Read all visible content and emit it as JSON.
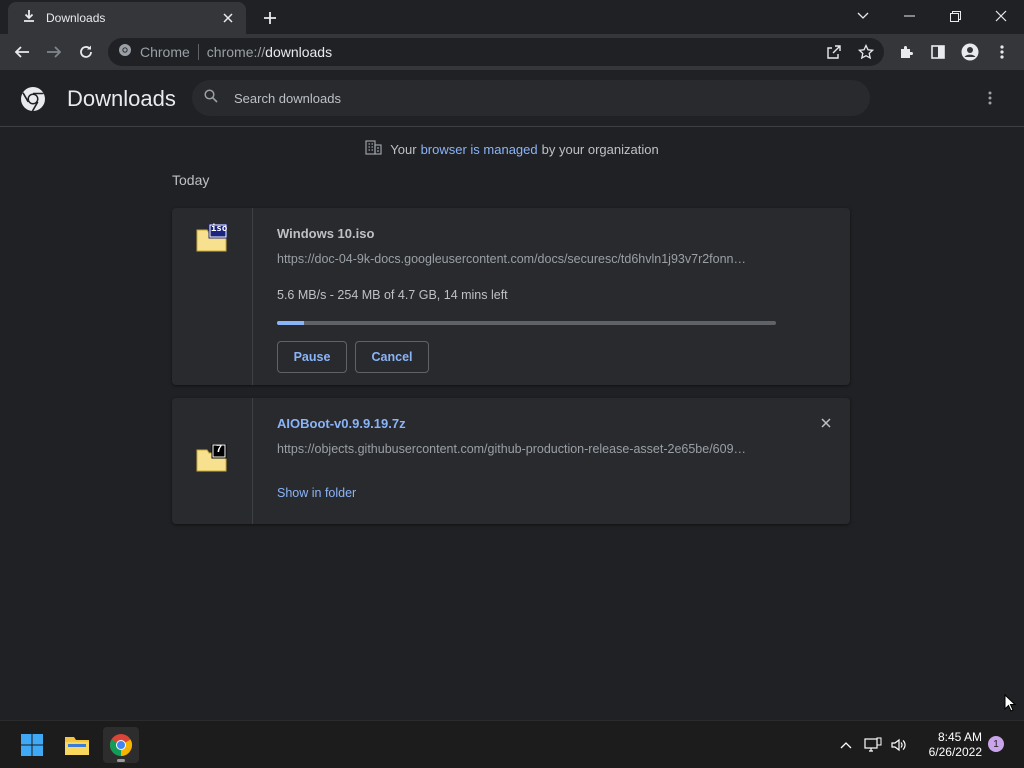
{
  "tab": {
    "title": "Downloads"
  },
  "omnibox": {
    "site": "Chrome",
    "url_prefix": "chrome://",
    "url_path": "downloads"
  },
  "header": {
    "title": "Downloads",
    "search_placeholder": "Search downloads"
  },
  "managed": {
    "prefix": "Your",
    "link": "browser is managed",
    "suffix": "by your organization"
  },
  "section": {
    "date": "Today"
  },
  "downloads": [
    {
      "name": "Windows 10.iso",
      "url": "https://doc-04-9k-docs.googleusercontent.com/docs/securesc/td6hvln1j93v7r2fonn…",
      "status": "5.6 MB/s - 254 MB of 4.7 GB, 14 mins left",
      "progress_fraction": 0.054,
      "icon_label": "iso",
      "pause_label": "Pause",
      "cancel_label": "Cancel"
    },
    {
      "name": "AIOBoot-v0.9.9.19.7z",
      "url": "https://objects.githubusercontent.com/github-production-release-asset-2e65be/609…",
      "icon_label": "7",
      "show_folder_label": "Show in folder"
    }
  ],
  "taskbar": {
    "time": "8:45 AM",
    "date": "6/26/2022",
    "notifications": "1"
  },
  "colors": {
    "accent": "#8ab4f8",
    "background": "#202124",
    "card": "#292a2d",
    "toolbar": "#35363a"
  }
}
